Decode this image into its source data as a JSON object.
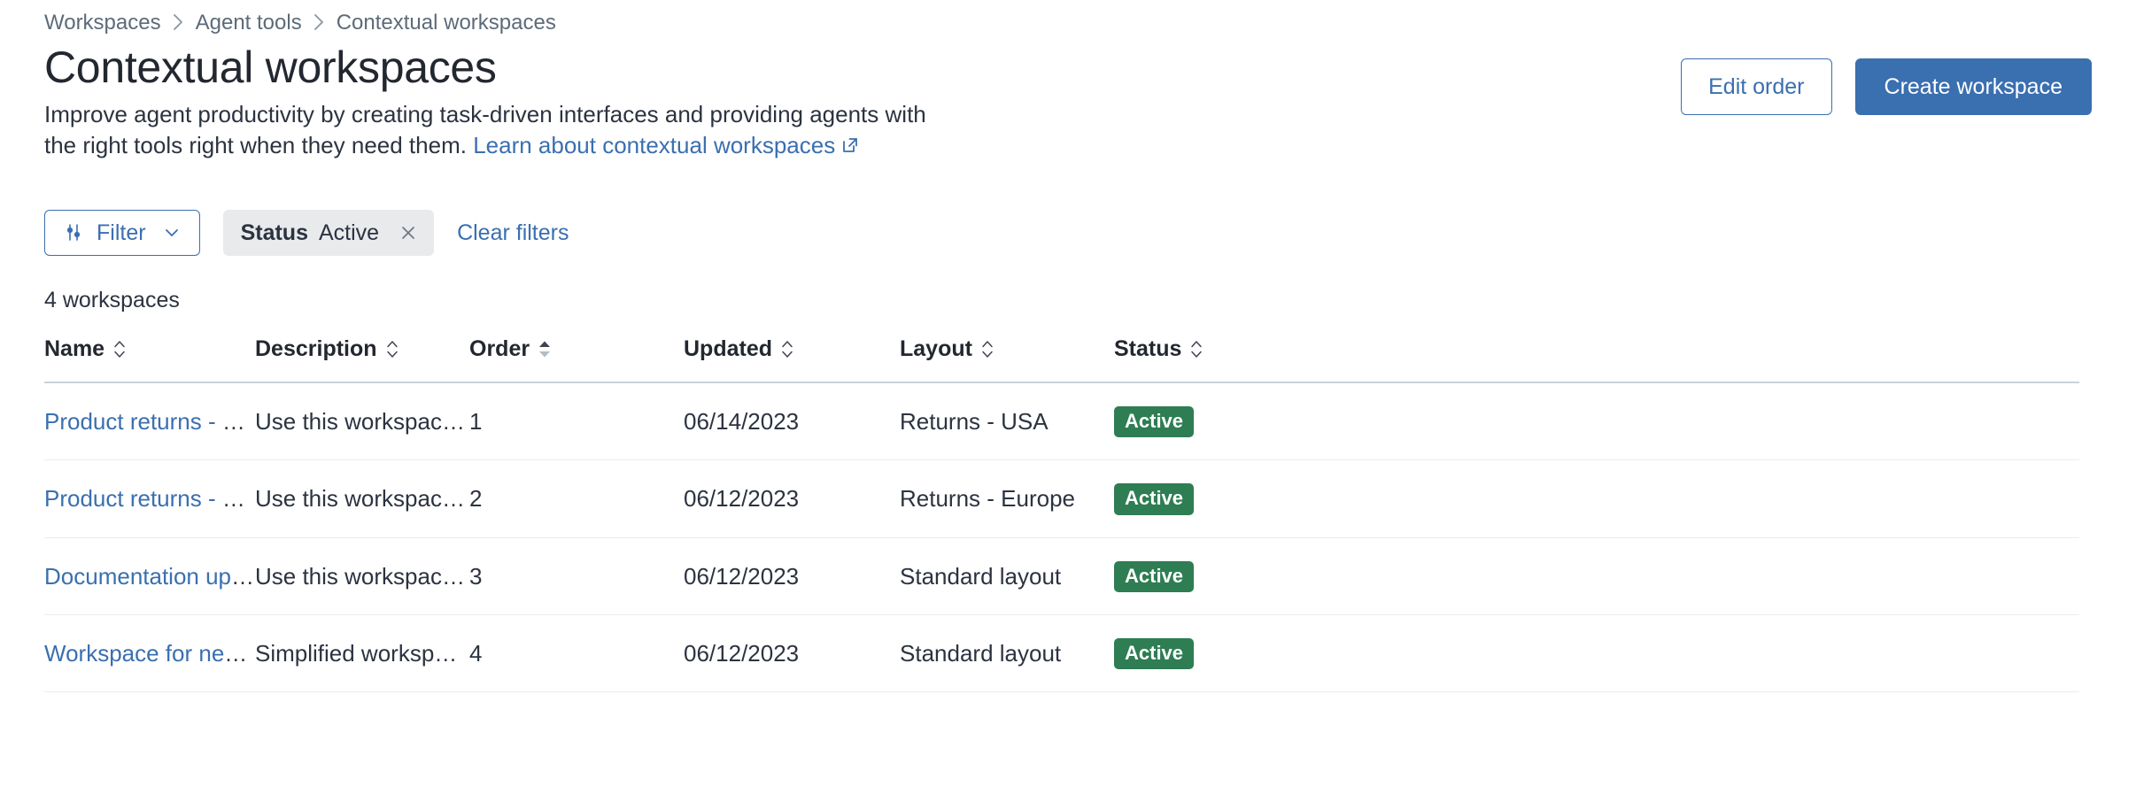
{
  "breadcrumb": {
    "items": [
      {
        "label": "Workspaces"
      },
      {
        "label": "Agent tools"
      },
      {
        "label": "Contextual workspaces"
      }
    ],
    "separator_icon": "chevron-right-icon"
  },
  "header": {
    "title": "Contextual workspaces",
    "description_line1": "Improve agent productivity by creating task-driven interfaces and providing agents",
    "description_line2": "with the right tools right when they need them.",
    "link_label": "Learn about contextual workspaces",
    "link_icon": "external-link-icon",
    "edit_order_label": "Edit order",
    "create_workspace_label": "Create workspace"
  },
  "filters": {
    "filter_button_label": "Filter",
    "filter_icon": "sliders-icon",
    "caret_icon": "chevron-down-icon",
    "active_pill": {
      "key": "Status",
      "value": "Active",
      "remove_icon": "close-icon"
    },
    "clear_filters_label": "Clear filters"
  },
  "results": {
    "count_label": "4 workspaces"
  },
  "table": {
    "columns": [
      {
        "label": "Name",
        "sort": "none"
      },
      {
        "label": "Description",
        "sort": "none"
      },
      {
        "label": "Order",
        "sort": "asc"
      },
      {
        "label": "Updated",
        "sort": "none"
      },
      {
        "label": "Layout",
        "sort": "none"
      },
      {
        "label": "Status",
        "sort": "none"
      }
    ],
    "rows": [
      {
        "name": "Product returns - USA",
        "description": "Use this workspace for...",
        "order": "1",
        "updated": "06/14/2023",
        "layout": "Returns - USA",
        "status": "Active"
      },
      {
        "name": "Product returns - Euro...",
        "description": "Use this workspace for...",
        "order": "2",
        "updated": "06/12/2023",
        "layout": "Returns - Europe",
        "status": "Active"
      },
      {
        "name": "Documentation updates",
        "description": "Use this workspace to ...",
        "order": "3",
        "updated": "06/12/2023",
        "layout": "Standard layout",
        "status": "Active"
      },
      {
        "name": "Workspace for new ag...",
        "description": "Simplified workspace f...",
        "order": "4",
        "updated": "06/12/2023",
        "layout": "Standard layout",
        "status": "Active"
      }
    ]
  },
  "colors": {
    "accent_blue": "#3a6fb0",
    "status_green": "#2e7d53",
    "text_primary": "#2c3340",
    "text_muted": "#5d6b79",
    "pill_bg": "#e8eaec",
    "border": "#eaecee"
  }
}
